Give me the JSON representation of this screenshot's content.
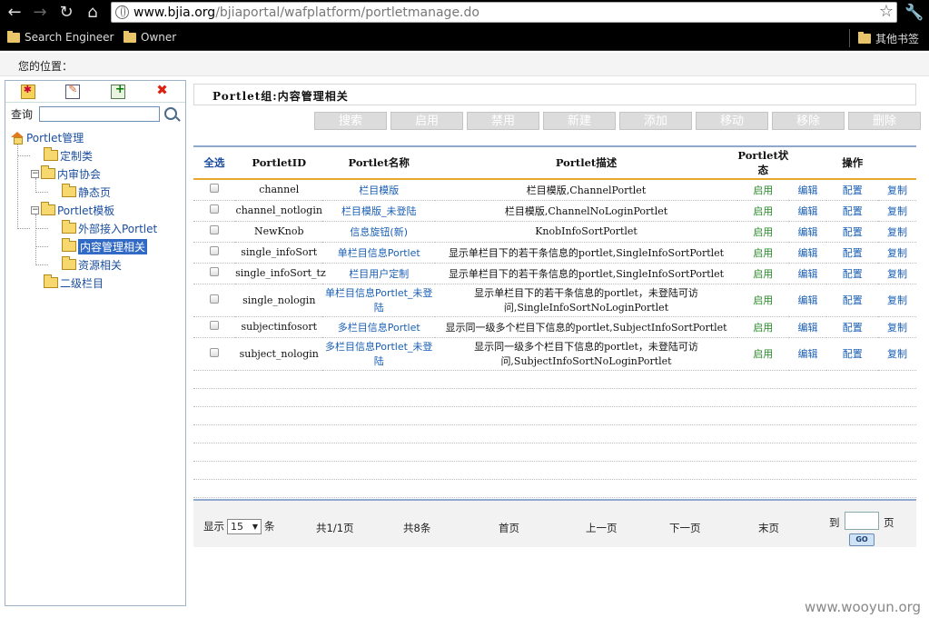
{
  "browser": {
    "url_host": "www.bjia.org",
    "url_path": "/bjiaportal/wafplatform/portletmanage.do",
    "bookmarks": [
      "Search Engineer",
      "Owner"
    ],
    "other_bookmarks": "其他书签"
  },
  "location": "您的位置：",
  "sidebar": {
    "search_label": "查询",
    "search_value": "",
    "tree": {
      "root": "Portlet管理",
      "items": [
        "定制类",
        "内审协会",
        "静态页",
        "Portlet模板",
        "外部接入Portlet",
        "内容管理相关",
        "资源相关",
        "二级栏目"
      ]
    }
  },
  "group_title": "Portlet组:内容管理相关",
  "actions": [
    "搜索",
    "启用",
    "禁用",
    "新建",
    "添加",
    "移动",
    "移除",
    "删除"
  ],
  "table": {
    "headers": {
      "select_all": "全选",
      "id": "PortletID",
      "name": "Portlet名称",
      "desc": "Portlet描述",
      "status": "Portlet状态",
      "ops": "操作"
    },
    "rows": [
      {
        "id": "channel",
        "name": "栏目模版",
        "desc": "栏目模版,ChannelPortlet",
        "status": "启用"
      },
      {
        "id": "channel_notlogin",
        "name": "栏目模版_未登陆",
        "desc": "栏目模版,ChannelNoLoginPortlet",
        "status": "启用"
      },
      {
        "id": "NewKnob",
        "name": "信息旋钮(新)",
        "desc": "KnobInfoSortPortlet",
        "status": "启用"
      },
      {
        "id": "single_infoSort",
        "name": "单栏目信息Portlet",
        "desc": "显示单栏目下的若干条信息的portlet,SingleInfoSortPortlet",
        "status": "启用"
      },
      {
        "id": "single_infoSort_tz",
        "name": "栏目用户定制",
        "desc": "显示单栏目下的若干条信息的portlet,SingleInfoSortPortlet",
        "status": "启用"
      },
      {
        "id": "single_nologin",
        "name": "单栏目信息Portlet_未登陆",
        "desc": "显示单栏目下的若干条信息的portlet，未登陆可访问,SingleInfoSortNoLoginPortlet",
        "status": "启用"
      },
      {
        "id": "subjectinfosort",
        "name": "多栏目信息Portlet",
        "desc": "显示同一级多个栏目下信息的portlet,SubjectInfoSortPortlet",
        "status": "启用"
      },
      {
        "id": "subject_nologin",
        "name": "多栏目信息Portlet_未登陆",
        "desc": "显示同一级多个栏目下信息的portlet，未登陆可访问,SubjectInfoSortNoLoginPortlet",
        "status": "启用"
      }
    ],
    "op_labels": [
      "编辑",
      "配置",
      "复制"
    ]
  },
  "pager": {
    "show_label": "显示",
    "page_size": "15",
    "unit": "条",
    "pages": "共1/1页",
    "total": "共8条",
    "first": "首页",
    "prev": "上一页",
    "next": "下一页",
    "last": "末页",
    "goto_prefix": "到",
    "goto_suffix": "页",
    "goto_value": "",
    "go": "GO"
  },
  "watermark": "www.wooyun.org"
}
